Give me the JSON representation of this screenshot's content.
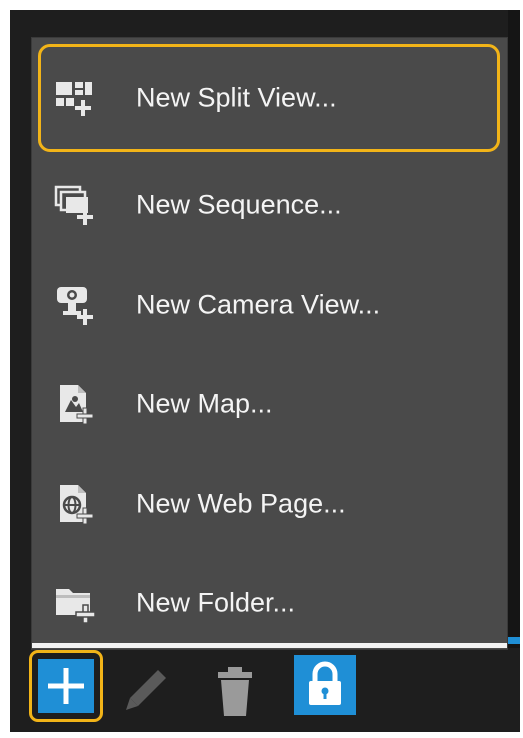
{
  "menu": {
    "items": [
      {
        "label": "New Split View...",
        "icon": "split-view-icon",
        "highlighted": true
      },
      {
        "label": "New Sequence...",
        "icon": "sequence-icon",
        "highlighted": false
      },
      {
        "label": "New Camera View...",
        "icon": "camera-view-icon",
        "highlighted": false
      },
      {
        "label": "New Map...",
        "icon": "map-icon",
        "highlighted": false
      },
      {
        "label": "New Web Page...",
        "icon": "web-page-icon",
        "highlighted": false
      },
      {
        "label": "New Folder...",
        "icon": "folder-icon",
        "highlighted": false
      }
    ]
  },
  "toolbar": {
    "buttons": [
      {
        "icon": "add-icon",
        "highlighted": true
      },
      {
        "icon": "edit-pencil-icon",
        "highlighted": false
      },
      {
        "icon": "trash-icon",
        "highlighted": false
      },
      {
        "icon": "lock-icon",
        "highlighted": false
      }
    ]
  },
  "colors": {
    "menu_background": "#4a4a4a",
    "highlight_border": "#f2b418",
    "accent_blue": "#1f8fd6",
    "text": "#f4f4f4"
  }
}
